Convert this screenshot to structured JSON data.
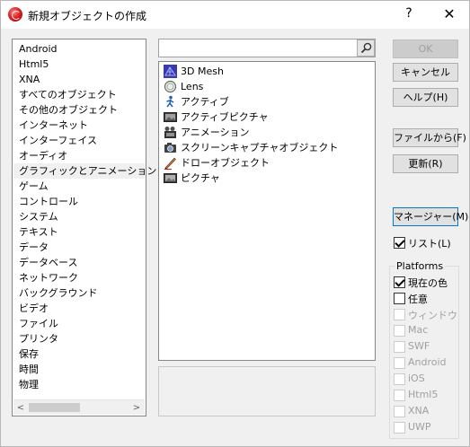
{
  "window": {
    "title": "新規オブジェクトの作成",
    "help_label": "?",
    "close_label": "✕"
  },
  "categories": [
    {
      "label": "Android"
    },
    {
      "label": "Html5"
    },
    {
      "label": "XNA"
    },
    {
      "label": "すべてのオブジェクト"
    },
    {
      "label": "その他のオブジェクト"
    },
    {
      "label": "インターネット"
    },
    {
      "label": "インターフェイス"
    },
    {
      "label": "オーディオ"
    },
    {
      "label": "グラフィックとアニメーション",
      "selected": true
    },
    {
      "label": "ゲーム"
    },
    {
      "label": "コントロール"
    },
    {
      "label": "システム"
    },
    {
      "label": "テキスト"
    },
    {
      "label": "データ"
    },
    {
      "label": "データベース"
    },
    {
      "label": "ネットワーク"
    },
    {
      "label": "バックグラウンド"
    },
    {
      "label": "ビデオ"
    },
    {
      "label": "ファイル"
    },
    {
      "label": "プリンタ"
    },
    {
      "label": "保存"
    },
    {
      "label": "時間"
    },
    {
      "label": "物理"
    }
  ],
  "scroll": {
    "left": "<",
    "right": ">"
  },
  "search": {
    "value": "",
    "placeholder": ""
  },
  "objects": [
    {
      "label": "3D Mesh",
      "icon": "3d-mesh-icon"
    },
    {
      "label": "Lens",
      "icon": "lens-icon"
    },
    {
      "label": "アクティブ",
      "icon": "active-icon"
    },
    {
      "label": "アクティブピクチャ",
      "icon": "active-picture-icon"
    },
    {
      "label": "アニメーション",
      "icon": "animation-icon"
    },
    {
      "label": "スクリーンキャプチャオブジェクト",
      "icon": "screen-capture-icon"
    },
    {
      "label": "ドローオブジェクト",
      "icon": "draw-object-icon"
    },
    {
      "label": "ピクチャ",
      "icon": "picture-icon"
    }
  ],
  "buttons": {
    "ok": "OK",
    "cancel": "キャンセル",
    "help": "ヘルプ(H)",
    "from_file": "ファイルから(F)",
    "refresh": "更新(R)",
    "manager": "マネージャー(M)"
  },
  "list_checkbox": {
    "label": "リスト(L)",
    "checked": true
  },
  "platforms": {
    "title": "Platforms",
    "items": [
      {
        "label": "現在の色",
        "checked": true,
        "enabled": true
      },
      {
        "label": "任意",
        "checked": false,
        "enabled": true
      },
      {
        "label": "ウィンドウ",
        "checked": false,
        "enabled": false
      },
      {
        "label": "Mac",
        "checked": false,
        "enabled": false
      },
      {
        "label": "SWF",
        "checked": false,
        "enabled": false
      },
      {
        "label": "Android",
        "checked": false,
        "enabled": false
      },
      {
        "label": "iOS",
        "checked": false,
        "enabled": false
      },
      {
        "label": "Html5",
        "checked": false,
        "enabled": false
      },
      {
        "label": "XNA",
        "checked": false,
        "enabled": false
      },
      {
        "label": "UWP",
        "checked": false,
        "enabled": false
      }
    ]
  }
}
